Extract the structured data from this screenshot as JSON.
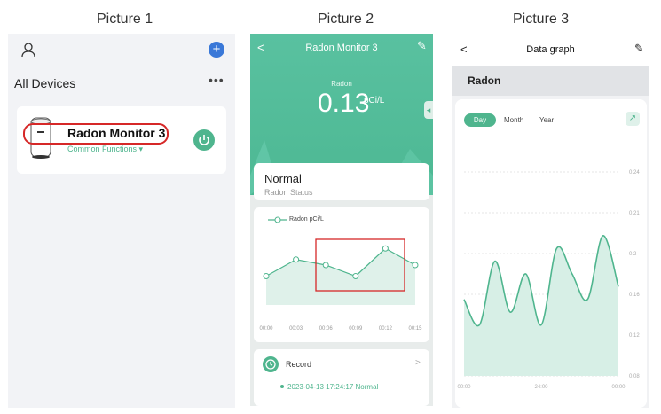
{
  "captions": [
    "Picture 1",
    "Picture 2",
    "Picture 3"
  ],
  "colors": {
    "accent": "#4fb58e",
    "highlight": "#d62828",
    "blue": "#3a78d8"
  },
  "picture1": {
    "profile_icon": "user-icon",
    "add_icon": "plus-icon",
    "title": "All Devices",
    "more_icon": "ellipsis-icon",
    "device": {
      "name": "Radon Monitor 3",
      "subtitle": "Common Functions ▾",
      "power_icon": "power-icon"
    }
  },
  "picture2": {
    "header_title": "Radon Monitor 3",
    "radon_label": "Radon",
    "radon_value": "0.13",
    "radon_unit": "pCi/L",
    "status_value": "Normal",
    "status_label": "Radon Status",
    "legend": "Radon pCi/L",
    "chart_data": {
      "type": "line",
      "x": [
        "00:00",
        "00:03",
        "00:06",
        "00:09",
        "00:12",
        "00:15"
      ],
      "values": [
        0.1,
        0.13,
        0.12,
        0.1,
        0.15,
        0.12
      ],
      "ylabel": "Radon pCi/L"
    },
    "record_title": "Record",
    "record_entry": "2023-04-13 17:24:17 Normal"
  },
  "picture3": {
    "title": "Data graph",
    "section_title": "Radon",
    "tabs": [
      "Day",
      "Month",
      "Year"
    ],
    "chart_data": {
      "type": "area",
      "x_ticks": [
        "00:00",
        "24:00",
        "00:00"
      ],
      "y_ticks": [
        "0.24",
        "0.21",
        "0.2",
        "0.16",
        "0.12",
        "0.08"
      ],
      "values": [
        0.14,
        0.12,
        0.17,
        0.13,
        0.16,
        0.12,
        0.18,
        0.16,
        0.14,
        0.19,
        0.15
      ],
      "ylim": [
        0.08,
        0.24
      ]
    }
  }
}
